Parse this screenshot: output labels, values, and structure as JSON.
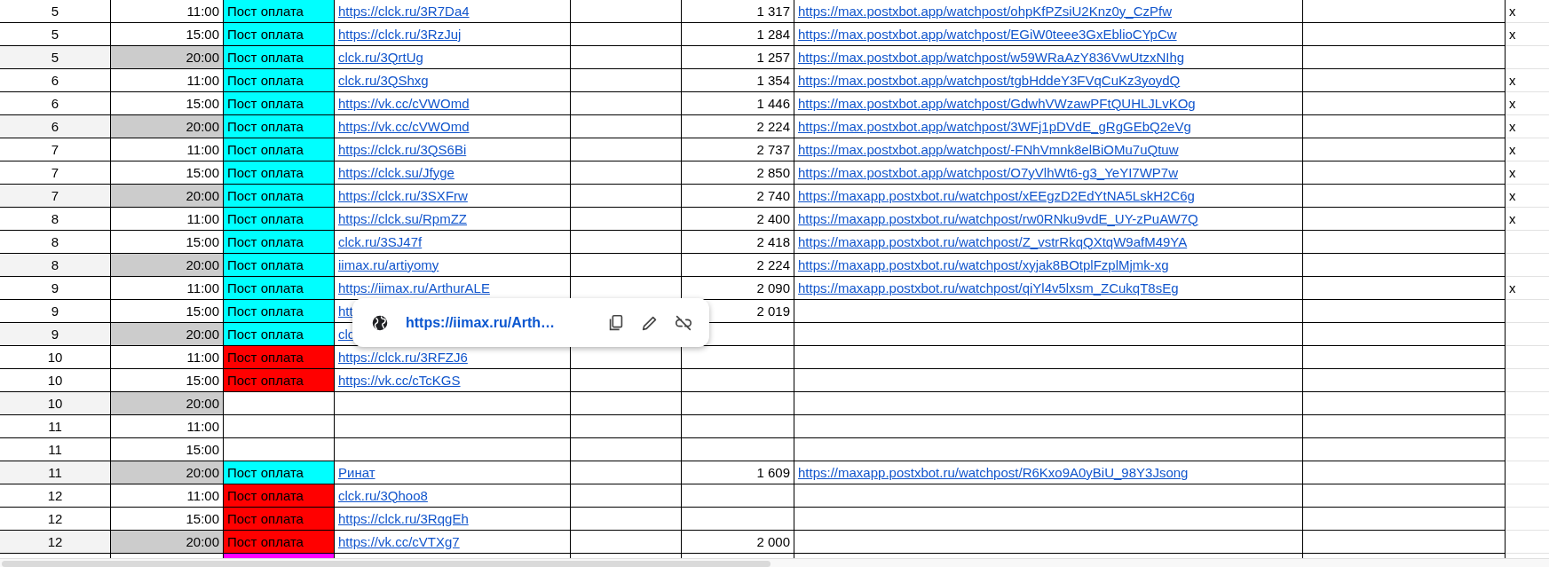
{
  "rows": [
    {
      "day": "5",
      "time": "11:00",
      "shaded": false,
      "status": {
        "label": "Пост оплата",
        "color": "#00ffff"
      },
      "link": "https://clck.ru/3R7Da4",
      "count": "1 317",
      "post_link": "https://max.postxbot.app/watchpost/ohpKfPZsiU2Knz0y_CzPfw",
      "mark": "x"
    },
    {
      "day": "5",
      "time": "15:00",
      "shaded": false,
      "status": {
        "label": "Пост оплата",
        "color": "#00ffff"
      },
      "link": "https://clck.ru/3RzJuj",
      "count": "1 284",
      "post_link": "https://max.postxbot.app/watchpost/EGiW0teee3GxEblioCYpCw",
      "mark": "x"
    },
    {
      "day": "5",
      "time": "20:00",
      "shaded": true,
      "status": {
        "label": "Пост оплата",
        "color": "#00ffff"
      },
      "link": "clck.ru/3QrtUg",
      "count": "1 257",
      "post_link": "https://max.postxbot.app/watchpost/w59WRaAzY836VwUtzxNIhg"
    },
    {
      "day": "6",
      "time": "11:00",
      "shaded": false,
      "status": {
        "label": "Пост оплата",
        "color": "#00ffff"
      },
      "link": "clck.ru/3QShxg",
      "count": "1 354",
      "post_link": "https://max.postxbot.app/watchpost/tgbHddeY3FVqCuKz3yoydQ",
      "mark": "x"
    },
    {
      "day": "6",
      "time": "15:00",
      "shaded": false,
      "status": {
        "label": "Пост оплата",
        "color": "#00ffff"
      },
      "link": "https://vk.cc/cVWOmd",
      "count": "1 446",
      "post_link": "https://max.postxbot.app/watchpost/GdwhVWzawPFtQUHLJLvKOg",
      "mark": "x"
    },
    {
      "day": "6",
      "time": "20:00",
      "shaded": true,
      "status": {
        "label": "Пост оплата",
        "color": "#00ffff"
      },
      "link": "https://vk.cc/cVWOmd",
      "count": "2 224",
      "post_link": "https://max.postxbot.app/watchpost/3WFj1pDVdE_gRgGEbQ2eVg",
      "mark": "x"
    },
    {
      "day": "7",
      "time": "11:00",
      "shaded": false,
      "status": {
        "label": "Пост оплата",
        "color": "#00ffff"
      },
      "link": "https://clck.ru/3QS6Bi",
      "count": "2 737",
      "post_link": "https://max.postxbot.app/watchpost/-FNhVmnk8elBiOMu7uQtuw",
      "mark": "x"
    },
    {
      "day": "7",
      "time": "15:00",
      "shaded": false,
      "status": {
        "label": "Пост оплата",
        "color": "#00ffff"
      },
      "link": "https://clck.su/Jfyge",
      "count": "2 850",
      "post_link": "https://max.postxbot.app/watchpost/O7yVlhWt6-g3_YeYI7WP7w",
      "mark": "x"
    },
    {
      "day": "7",
      "time": "20:00",
      "shaded": true,
      "status": {
        "label": "Пост оплата",
        "color": "#00ffff"
      },
      "link": "https://clck.ru/3SXFrw",
      "count": "2 740",
      "post_link": "https://maxapp.postxbot.ru/watchpost/xEEgzD2EdYtNA5LskH2C6g",
      "mark": "x"
    },
    {
      "day": "8",
      "time": "11:00",
      "shaded": false,
      "status": {
        "label": "Пост оплата",
        "color": "#00ffff"
      },
      "link": "https://clck.su/RpmZZ",
      "count": "2 400",
      "post_link": "https://maxapp.postxbot.ru/watchpost/rw0RNku9vdE_UY-zPuAW7Q",
      "mark": "x"
    },
    {
      "day": "8",
      "time": "15:00",
      "shaded": false,
      "status": {
        "label": "Пост оплата",
        "color": "#00ffff"
      },
      "link": "clck.ru/3SJ47f",
      "count": "2 418",
      "post_link": "https://maxapp.postxbot.ru/watchpost/Z_vstrRkqQXtqW9afM49YA"
    },
    {
      "day": "8",
      "time": "20:00",
      "shaded": true,
      "status": {
        "label": "Пост оплата",
        "color": "#00ffff"
      },
      "link": "iimax.ru/artiyomy",
      "count": "2 224",
      "post_link": "https://maxapp.postxbot.ru/watchpost/xyjak8BOtplFzplMjmk-xg"
    },
    {
      "day": "9",
      "time": "11:00",
      "shaded": false,
      "status": {
        "label": "Пост оплата",
        "color": "#00ffff"
      },
      "link": "https://iimax.ru/ArthurALE",
      "count": "2 090",
      "post_link": "https://maxapp.postxbot.ru/watchpost/qiYl4v5lxsm_ZCukqT8sEg",
      "mark": "x"
    },
    {
      "day": "9",
      "time": "15:00",
      "shaded": false,
      "status": {
        "label": "Пост оплата",
        "color": "#00ffff"
      },
      "link": "htt",
      "count": "2 019"
    },
    {
      "day": "9",
      "time": "20:00",
      "shaded": true,
      "status": {
        "label": "Пост оплата",
        "color": "#00ffff"
      },
      "link": "clc"
    },
    {
      "day": "10",
      "time": "11:00",
      "shaded": false,
      "status": {
        "label": "Пост оплата",
        "color": "#ff0000"
      },
      "link": "https://clck.ru/3RFZJ6"
    },
    {
      "day": "10",
      "time": "15:00",
      "shaded": false,
      "status": {
        "label": "Пост оплата",
        "color": "#ff0000"
      },
      "link": "https://vk.cc/cTcKGS"
    },
    {
      "day": "10",
      "time": "20:00",
      "shaded": true
    },
    {
      "day": "11",
      "time": "11:00",
      "shaded": false
    },
    {
      "day": "11",
      "time": "15:00",
      "shaded": false
    },
    {
      "day": "11",
      "time": "20:00",
      "shaded": true,
      "status": {
        "label": "Пост оплата",
        "color": "#00ffff"
      },
      "link": "Ринат",
      "count": "1 609",
      "post_link": "https://maxapp.postxbot.ru/watchpost/R6Kxo9A0yBiU_98Y3Jsong"
    },
    {
      "day": "12",
      "time": "11:00",
      "shaded": false,
      "status": {
        "label": "Пост оплата",
        "color": "#ff0000"
      },
      "link": "clck.ru/3Qhoo8"
    },
    {
      "day": "12",
      "time": "15:00",
      "shaded": false,
      "status": {
        "label": "Пост оплата",
        "color": "#ff0000"
      },
      "link": "https://clck.ru/3RqgEh"
    },
    {
      "day": "12",
      "time": "20:00",
      "shaded": true,
      "status": {
        "label": "Пост оплата",
        "color": "#ff0000"
      },
      "link": "https://vk.cc/cVTXg7",
      "count": "2 000"
    },
    {
      "status": {
        "color": "#ff00ff"
      }
    }
  ],
  "link_popup": {
    "url": "https://iimax.ru/Arth…"
  }
}
